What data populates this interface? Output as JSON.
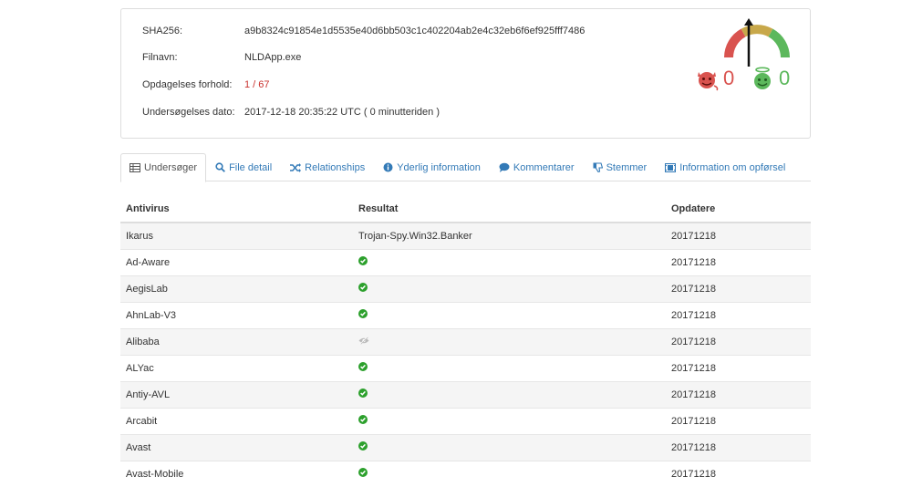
{
  "summary": {
    "sha_label": "SHA256:",
    "sha_value": "a9b8324c91854e1d5535e40d6bb503c1c402204ab2e4c32eb6f6ef925fff7486",
    "filename_label": "Filnavn:",
    "filename_value": "NLDApp.exe",
    "ratio_label": "Opdagelses forhold:",
    "ratio_value": "1 / 67",
    "date_label": "Undersøgelses dato:",
    "date_value": "2017-12-18 20:35:22 UTC ( 0 minutteriden )"
  },
  "votes": {
    "malicious": "0",
    "harmless": "0",
    "colors": {
      "malicious": "#d9534f",
      "harmless": "#5cb85c"
    }
  },
  "tabs": [
    {
      "label": "Undersøger",
      "icon": "table-icon",
      "active": true
    },
    {
      "label": "File detail",
      "icon": "search-icon"
    },
    {
      "label": "Relationships",
      "icon": "shuffle-icon"
    },
    {
      "label": "Yderlig information",
      "icon": "info-icon"
    },
    {
      "label": "Kommentarer",
      "icon": "comment-icon"
    },
    {
      "label": "Stemmer",
      "icon": "thumbs-down-icon"
    },
    {
      "label": "Information om opførsel",
      "icon": "film-icon"
    }
  ],
  "table": {
    "headers": [
      "Antivirus",
      "Resultat",
      "Opdatere"
    ],
    "rows": [
      {
        "av": "Ikarus",
        "result": "Trojan-Spy.Win32.Banker",
        "status": "detected",
        "date": "20171218"
      },
      {
        "av": "Ad-Aware",
        "result": "",
        "status": "clean",
        "date": "20171218"
      },
      {
        "av": "AegisLab",
        "result": "",
        "status": "clean",
        "date": "20171218"
      },
      {
        "av": "AhnLab-V3",
        "result": "",
        "status": "clean",
        "date": "20171218"
      },
      {
        "av": "Alibaba",
        "result": "",
        "status": "unsupported",
        "date": "20171218"
      },
      {
        "av": "ALYac",
        "result": "",
        "status": "clean",
        "date": "20171218"
      },
      {
        "av": "Antiy-AVL",
        "result": "",
        "status": "clean",
        "date": "20171218"
      },
      {
        "av": "Arcabit",
        "result": "",
        "status": "clean",
        "date": "20171218"
      },
      {
        "av": "Avast",
        "result": "",
        "status": "clean",
        "date": "20171218"
      },
      {
        "av": "Avast-Mobile",
        "result": "",
        "status": "clean",
        "date": "20171218"
      }
    ]
  }
}
